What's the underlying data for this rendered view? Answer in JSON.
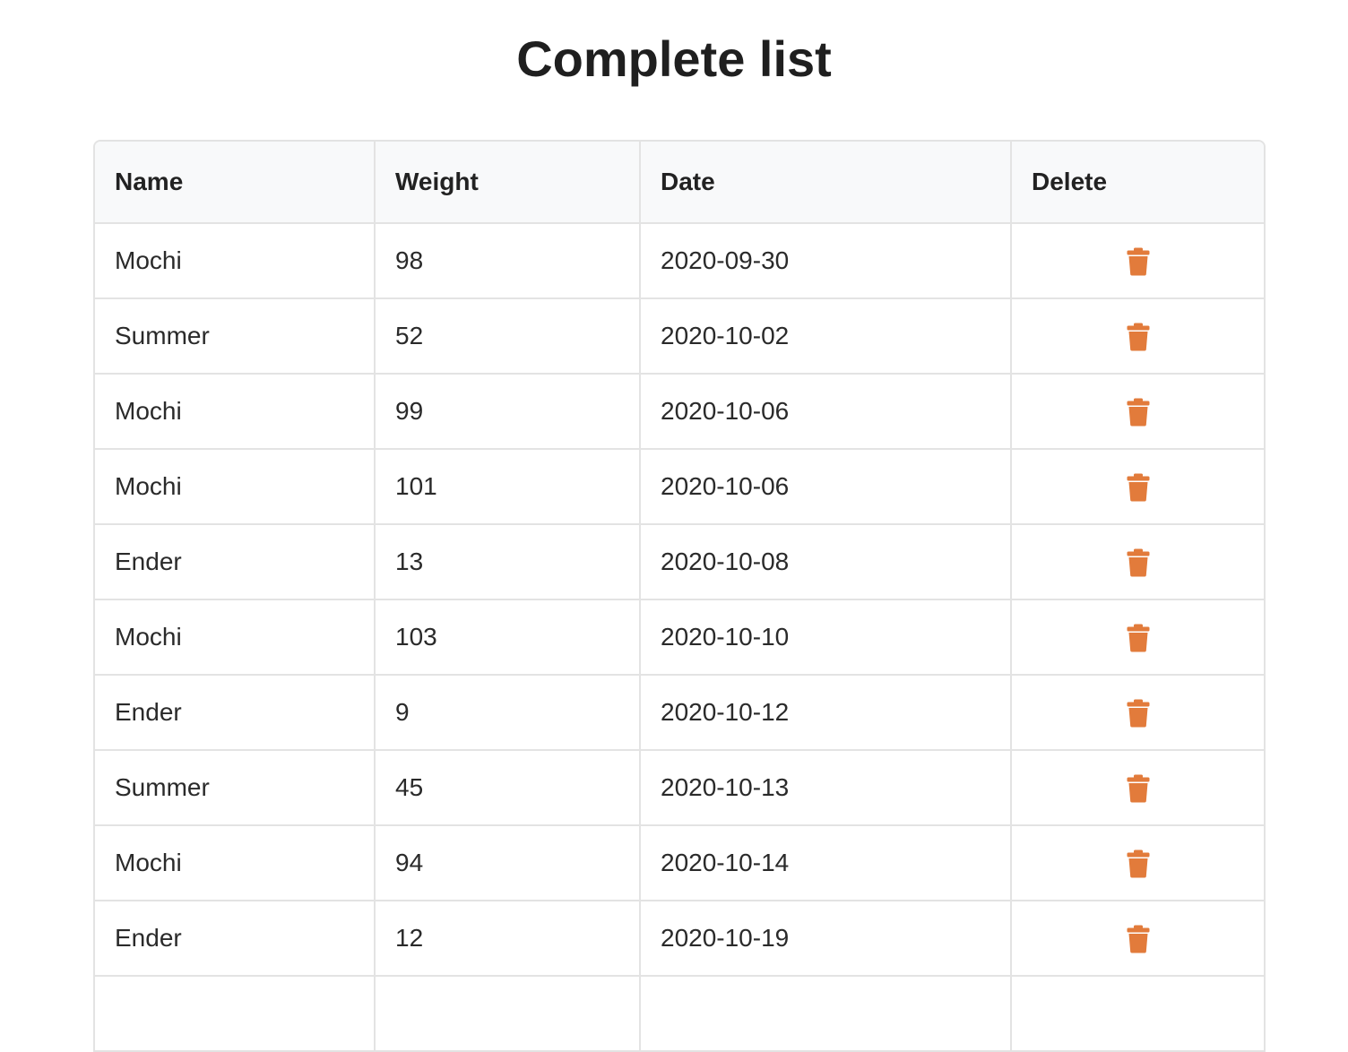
{
  "page": {
    "title": "Complete list"
  },
  "colors": {
    "accent": "#E27B3B",
    "border": "#E3E3E3",
    "header_bg": "#F8F9FA"
  },
  "table": {
    "headers": {
      "name": "Name",
      "weight": "Weight",
      "date": "Date",
      "delete": "Delete"
    },
    "delete_icon": "trash-icon",
    "rows": [
      {
        "name": "Mochi",
        "weight": "98",
        "date": "2020-09-30"
      },
      {
        "name": "Summer",
        "weight": "52",
        "date": "2020-10-02"
      },
      {
        "name": "Mochi",
        "weight": "99",
        "date": "2020-10-06"
      },
      {
        "name": "Mochi",
        "weight": "101",
        "date": "2020-10-06"
      },
      {
        "name": "Ender",
        "weight": "13",
        "date": "2020-10-08"
      },
      {
        "name": "Mochi",
        "weight": "103",
        "date": "2020-10-10"
      },
      {
        "name": "Ender",
        "weight": "9",
        "date": "2020-10-12"
      },
      {
        "name": "Summer",
        "weight": "45",
        "date": "2020-10-13"
      },
      {
        "name": "Mochi",
        "weight": "94",
        "date": "2020-10-14"
      },
      {
        "name": "Ender",
        "weight": "12",
        "date": "2020-10-19"
      },
      {
        "name": "",
        "weight": "",
        "date": ""
      }
    ]
  }
}
